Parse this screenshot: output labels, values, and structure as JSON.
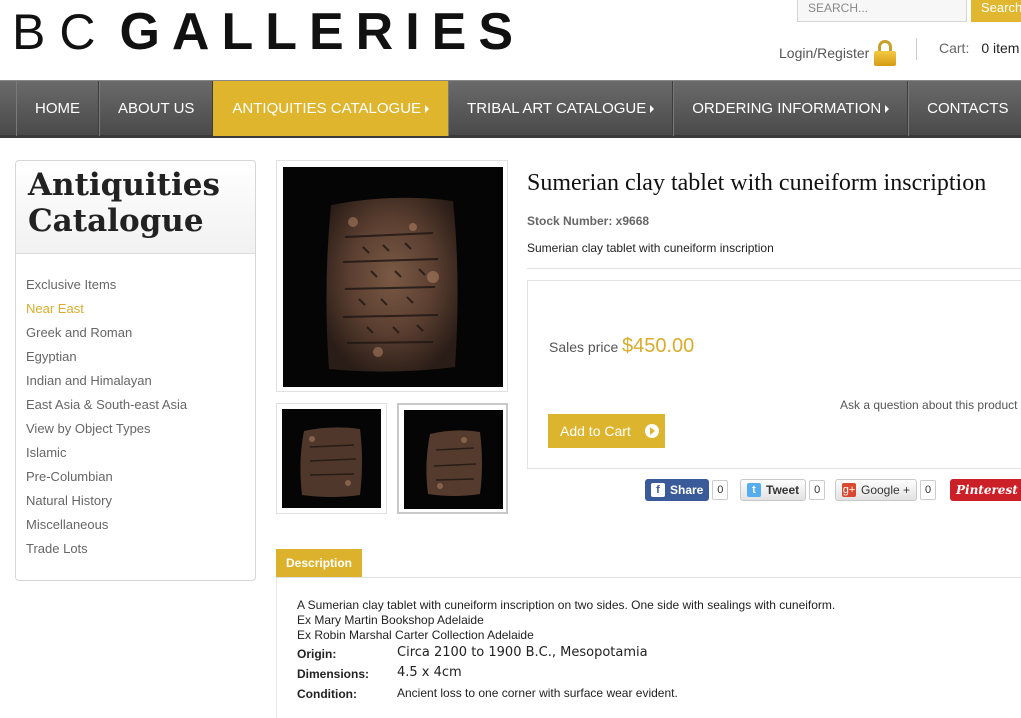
{
  "header": {
    "logo_part1": "BC",
    "logo_part2": "GALLERIES",
    "search_placeholder": "SEARCH...",
    "search_button": "Search",
    "login_label": "Login/Register",
    "cart_label": "Cart:",
    "cart_count": "0 item"
  },
  "nav": {
    "items": [
      {
        "label": "HOME"
      },
      {
        "label": "ABOUT US"
      },
      {
        "label": "ANTIQUITIES CATALOGUE"
      },
      {
        "label": "TRIBAL ART CATALOGUE"
      },
      {
        "label": "ORDERING INFORMATION"
      },
      {
        "label": "CONTACTS"
      }
    ],
    "active_index": 2
  },
  "sidebar": {
    "title_line1": "Antiquities",
    "title_line2": "Catalogue",
    "items": [
      {
        "label": "Exclusive Items"
      },
      {
        "label": "Near East"
      },
      {
        "label": "Greek and Roman"
      },
      {
        "label": "Egyptian"
      },
      {
        "label": "Indian and Himalayan"
      },
      {
        "label": "East Asia & South-east Asia"
      },
      {
        "label": "View by Object Types"
      },
      {
        "label": "Islamic"
      },
      {
        "label": "Pre-Columbian"
      },
      {
        "label": "Natural History"
      },
      {
        "label": "Miscellaneous"
      },
      {
        "label": "Trade Lots"
      }
    ],
    "active_index": 1
  },
  "product": {
    "title": "Sumerian clay tablet with cuneiform inscription",
    "stock_number": "Stock Number: x9668",
    "short_description": "Sumerian clay tablet with cuneiform inscription",
    "price_label": "Sales price",
    "price": "$450.00",
    "ask_link": "Ask a question about this product",
    "add_to_cart": "Add to Cart"
  },
  "social": {
    "facebook_label": "Share",
    "facebook_count": "0",
    "twitter_label": "Tweet",
    "twitter_count": "0",
    "google_label": "Google +",
    "google_count": "0",
    "pinterest_label": "Pinterest"
  },
  "description": {
    "tab_label": "Description",
    "line1": "A Sumerian clay tablet with cuneiform inscription on two sides. One side with sealings with cuneiform.",
    "line2": "Ex Mary Martin Bookshop Adelaide",
    "line3": "Ex Robin Marshal Carter Collection Adelaide",
    "origin_label": "Origin:",
    "origin_value": "Circa 2100 to 1900 B.C., Mesopotamia",
    "dimensions_label": "Dimensions:",
    "dimensions_value": "4.5 x 4cm",
    "condition_label": "Condition:",
    "condition_value": "Ancient loss to one corner with surface wear evident."
  },
  "colors": {
    "accent": "#dfb52e",
    "nav_bg": "#555555"
  }
}
